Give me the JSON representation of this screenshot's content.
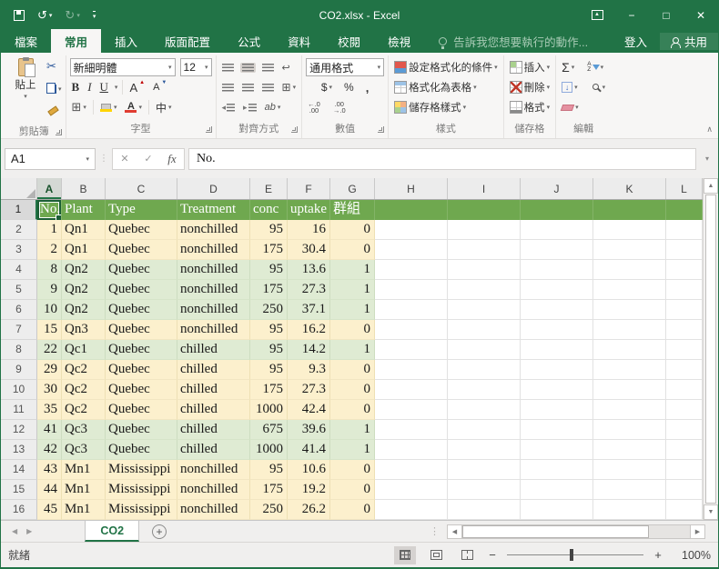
{
  "window": {
    "title": "CO2.xlsx - Excel"
  },
  "icons": {
    "undo": "↺",
    "redo": "↻",
    "dropdown": "▾",
    "cut": "✂",
    "minimize": "−",
    "maximize": "□",
    "close": "✕",
    "caret_up": "▲",
    "cancel": "✕",
    "check": "✓",
    "fx": "fx",
    "bold": "B",
    "italic": "I",
    "underline": "U",
    "font_grow": "A",
    "font_shrink": "A",
    "borders": "⊞",
    "merge": "⊞",
    "wrap": "↩",
    "indent_dec": "◂",
    "indent_inc": "▸",
    "orientation": "ab",
    "font_color_letter": "A",
    "phonetic": "中",
    "currency": "$",
    "percent": "%",
    "comma": ",",
    "dec_inc_top": "←.0",
    "dec_inc_bot": ".00",
    "dec_dec_top": ".00",
    "dec_dec_bot": "→.0",
    "sum": "Σ",
    "sort_a": "A",
    "sort_z": "Z",
    "fill_down": "↓",
    "collapse": "∧",
    "dots": "⋮",
    "plus": "+",
    "minus": "−",
    "left_arrow": "◀",
    "right_arrow": "▶",
    "up_arrow": "▲",
    "down_arrow": "▼"
  },
  "tabs": [
    {
      "id": "file",
      "label": "檔案",
      "active": false
    },
    {
      "id": "home",
      "label": "常用",
      "active": true
    },
    {
      "id": "insert",
      "label": "插入",
      "active": false
    },
    {
      "id": "layout",
      "label": "版面配置",
      "active": false
    },
    {
      "id": "formulas",
      "label": "公式",
      "active": false
    },
    {
      "id": "data",
      "label": "資料",
      "active": false
    },
    {
      "id": "review",
      "label": "校閱",
      "active": false
    },
    {
      "id": "view",
      "label": "檢視",
      "active": false
    }
  ],
  "tell_me": "告訴我您想要執行的動作...",
  "account": {
    "sign_in": "登入",
    "share": "共用"
  },
  "ribbon": {
    "clipboard": {
      "label": "剪貼簿",
      "paste": "貼上"
    },
    "font": {
      "label": "字型",
      "name": "新細明體",
      "size": "12"
    },
    "alignment": {
      "label": "對齊方式"
    },
    "number": {
      "label": "數值",
      "format": "通用格式"
    },
    "styles": {
      "label": "樣式",
      "conditional": "設定格式化的條件",
      "format_table": "格式化為表格",
      "cell_styles": "儲存格樣式"
    },
    "cells": {
      "label": "儲存格",
      "insert": "插入",
      "delete": "刪除",
      "format": "格式"
    },
    "editing": {
      "label": "編輯"
    }
  },
  "formula_bar": {
    "name_box": "A1",
    "value": "No."
  },
  "grid": {
    "column_headers": [
      "A",
      "B",
      "C",
      "D",
      "E",
      "F",
      "G",
      "H",
      "I",
      "J",
      "K",
      "L"
    ],
    "selected_column": "A",
    "selected_cell": "A1",
    "header_row": {
      "num": "1",
      "values": [
        "No.",
        "Plant",
        "Type",
        "Treatment",
        "conc",
        "uptake",
        "群組"
      ]
    },
    "data_rows": [
      {
        "num": "2",
        "band": "cream",
        "values": [
          "1",
          "Qn1",
          "Quebec",
          "nonchilled",
          "95",
          "16",
          "0"
        ]
      },
      {
        "num": "3",
        "band": "cream",
        "values": [
          "2",
          "Qn1",
          "Quebec",
          "nonchilled",
          "175",
          "30.4",
          "0"
        ]
      },
      {
        "num": "4",
        "band": "green",
        "values": [
          "8",
          "Qn2",
          "Quebec",
          "nonchilled",
          "95",
          "13.6",
          "1"
        ]
      },
      {
        "num": "5",
        "band": "green",
        "values": [
          "9",
          "Qn2",
          "Quebec",
          "nonchilled",
          "175",
          "27.3",
          "1"
        ]
      },
      {
        "num": "6",
        "band": "green",
        "values": [
          "10",
          "Qn2",
          "Quebec",
          "nonchilled",
          "250",
          "37.1",
          "1"
        ]
      },
      {
        "num": "7",
        "band": "cream",
        "values": [
          "15",
          "Qn3",
          "Quebec",
          "nonchilled",
          "95",
          "16.2",
          "0"
        ]
      },
      {
        "num": "8",
        "band": "green",
        "values": [
          "22",
          "Qc1",
          "Quebec",
          "chilled",
          "95",
          "14.2",
          "1"
        ]
      },
      {
        "num": "9",
        "band": "cream",
        "values": [
          "29",
          "Qc2",
          "Quebec",
          "chilled",
          "95",
          "9.3",
          "0"
        ]
      },
      {
        "num": "10",
        "band": "cream",
        "values": [
          "30",
          "Qc2",
          "Quebec",
          "chilled",
          "175",
          "27.3",
          "0"
        ]
      },
      {
        "num": "11",
        "band": "cream",
        "values": [
          "35",
          "Qc2",
          "Quebec",
          "chilled",
          "1000",
          "42.4",
          "0"
        ]
      },
      {
        "num": "12",
        "band": "green",
        "values": [
          "41",
          "Qc3",
          "Quebec",
          "chilled",
          "675",
          "39.6",
          "1"
        ]
      },
      {
        "num": "13",
        "band": "green",
        "values": [
          "42",
          "Qc3",
          "Quebec",
          "chilled",
          "1000",
          "41.4",
          "1"
        ]
      },
      {
        "num": "14",
        "band": "cream",
        "values": [
          "43",
          "Mn1",
          "Mississippi",
          "nonchilled",
          "95",
          "10.6",
          "0"
        ]
      },
      {
        "num": "15",
        "band": "cream",
        "values": [
          "44",
          "Mn1",
          "Mississippi",
          "nonchilled",
          "175",
          "19.2",
          "0"
        ]
      },
      {
        "num": "16",
        "band": "cream",
        "values": [
          "45",
          "Mn1",
          "Mississippi",
          "nonchilled",
          "250",
          "26.2",
          "0"
        ]
      }
    ]
  },
  "sheet_bar": {
    "sheet": "CO2"
  },
  "status_bar": {
    "status": "就緒",
    "zoom": "100%"
  },
  "colors": {
    "accent": "#217346",
    "table_header": "#6FA84F",
    "band_cream": "#FCF0CD",
    "band_green": "#DFEBD3"
  }
}
